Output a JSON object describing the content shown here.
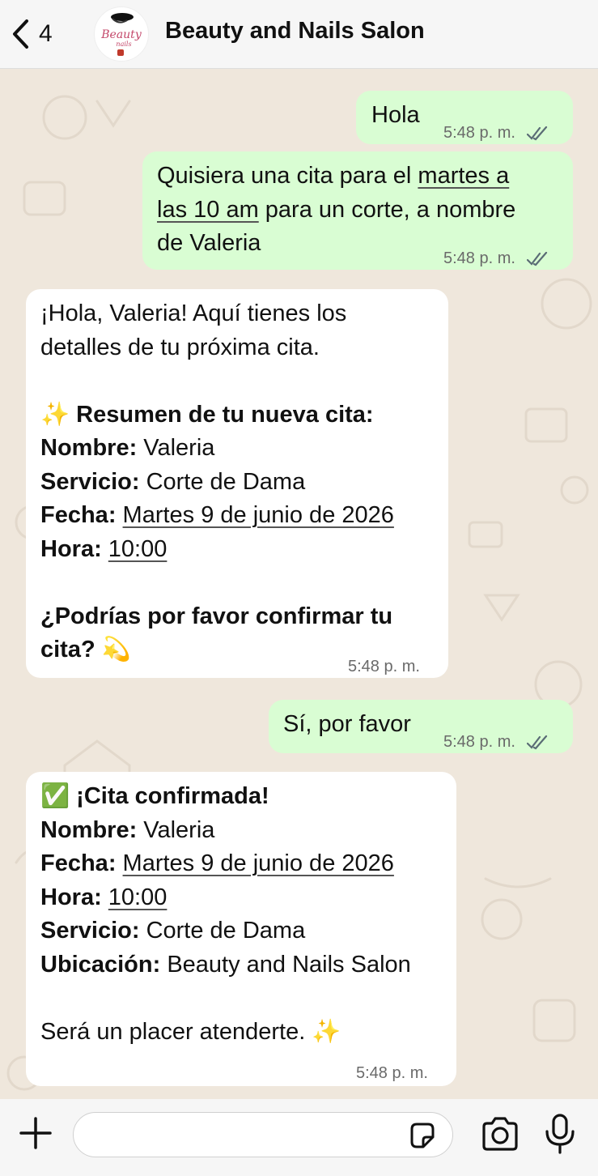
{
  "header": {
    "back_count": "4",
    "contact_name": "Beauty and Nails Salon",
    "avatar_text": "Beauty nails"
  },
  "messages": [
    {
      "id": "m1",
      "direction": "outgoing",
      "text": "Hola",
      "time": "5:48 p. m.",
      "status": "read"
    },
    {
      "id": "m2",
      "direction": "outgoing",
      "lines": [
        "Quisiera una cita para el martes a",
        "las 10 am para un corte, a nombre",
        "de Valeria"
      ],
      "link_text": "martes a las 10 am",
      "time": "5:48 p. m.",
      "status": "read"
    },
    {
      "id": "m3",
      "direction": "incoming",
      "greeting": [
        "¡Hola, Valeria! Aquí tienes los",
        "detalles de tu próxima cita."
      ],
      "summary_title": "✨ Resumen de tu nueva cita:",
      "fields": [
        {
          "label": "Nombre:",
          "value": "Valeria"
        },
        {
          "label": "Servicio:",
          "value": "Corte de Dama"
        },
        {
          "label": "Fecha:",
          "value": "Martes 9 de junio de 2026"
        },
        {
          "label": "Hora:",
          "value": "10:00"
        }
      ],
      "question": [
        "¿Podrías por favor confirmar tu",
        "cita? 💫"
      ],
      "time": "5:48 p. m."
    },
    {
      "id": "m4",
      "direction": "outgoing",
      "text": "Sí, por favor",
      "time": "5:48 p. m.",
      "status": "read"
    },
    {
      "id": "m5",
      "direction": "incoming",
      "title": "✅ ¡Cita confirmada!",
      "fields": [
        {
          "label": "Nombre:",
          "value": "Valeria"
        },
        {
          "label": "Fecha:",
          "value": "Martes 9 de junio de 2026"
        },
        {
          "label": "Hora:",
          "value": "10:00"
        },
        {
          "label": "Servicio:",
          "value": "Corte de Dama"
        },
        {
          "label": "Ubicación:",
          "value": "Beauty and Nails Salon"
        }
      ],
      "closing": "Será un placer atenderte. ✨",
      "time": "5:48 p. m."
    }
  ],
  "composer": {
    "placeholder": ""
  },
  "icons": {
    "back": "chevron-left-icon",
    "sticker": "sticker-icon",
    "attach": "plus-icon",
    "camera": "camera-icon",
    "mic": "microphone-icon",
    "read": "double-check-icon"
  },
  "colors": {
    "outgoing_bubble": "#d9fdd3",
    "incoming_bubble": "#ffffff",
    "chat_background": "#efe7dc",
    "bar_background": "#f6f6f6",
    "read_ticks": "#5a6c75"
  }
}
